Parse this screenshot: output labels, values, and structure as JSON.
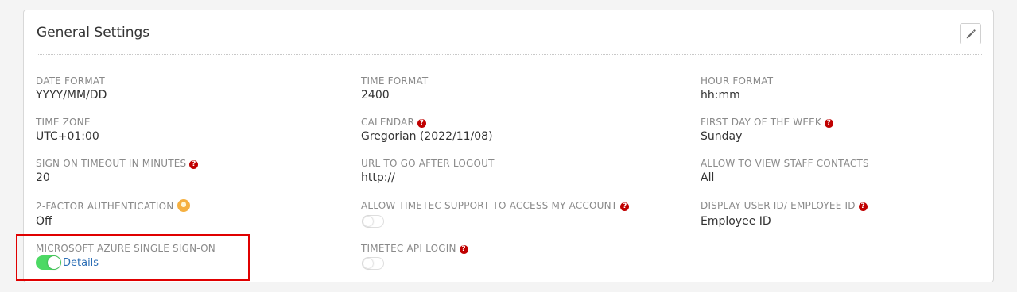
{
  "title": "General Settings",
  "icons": {
    "edit": "pencil-icon",
    "help": "question-icon",
    "bulb": "lightbulb-icon"
  },
  "colors": {
    "help": "#c00000",
    "toggle_on": "#4cd964",
    "link": "#2a6db5",
    "highlight": "#e00000"
  },
  "help_glyph": "?",
  "settings": {
    "date_format": {
      "label": "DATE FORMAT",
      "value": "YYYY/MM/DD"
    },
    "time_format": {
      "label": "TIME FORMAT",
      "value": "2400"
    },
    "hour_format": {
      "label": "HOUR FORMAT",
      "value": "hh:mm"
    },
    "time_zone": {
      "label": "TIME ZONE",
      "value": "UTC+01:00"
    },
    "calendar": {
      "label": "CALENDAR",
      "value": "Gregorian (2022/11/08)"
    },
    "first_day": {
      "label": "FIRST DAY OF THE WEEK",
      "value": "Sunday"
    },
    "sign_on_timeout": {
      "label": "SIGN ON TIMEOUT IN MINUTES",
      "value": "20"
    },
    "url_after_logout": {
      "label": "URL TO GO AFTER LOGOUT",
      "value": "http://"
    },
    "view_staff_contacts": {
      "label": "ALLOW TO VIEW STAFF CONTACTS",
      "value": "All"
    },
    "two_factor": {
      "label": "2-FACTOR AUTHENTICATION",
      "value": "Off"
    },
    "support_access": {
      "label": "ALLOW TIMETEC SUPPORT TO ACCESS MY ACCOUNT",
      "enabled": false
    },
    "display_user_id": {
      "label": "DISPLAY USER ID/ EMPLOYEE ID",
      "value": "Employee ID"
    },
    "azure_sso": {
      "label": "MICROSOFT AZURE SINGLE SIGN-ON",
      "enabled": true,
      "link": "Details"
    },
    "api_login": {
      "label": "TIMETEC API LOGIN",
      "enabled": false
    }
  }
}
